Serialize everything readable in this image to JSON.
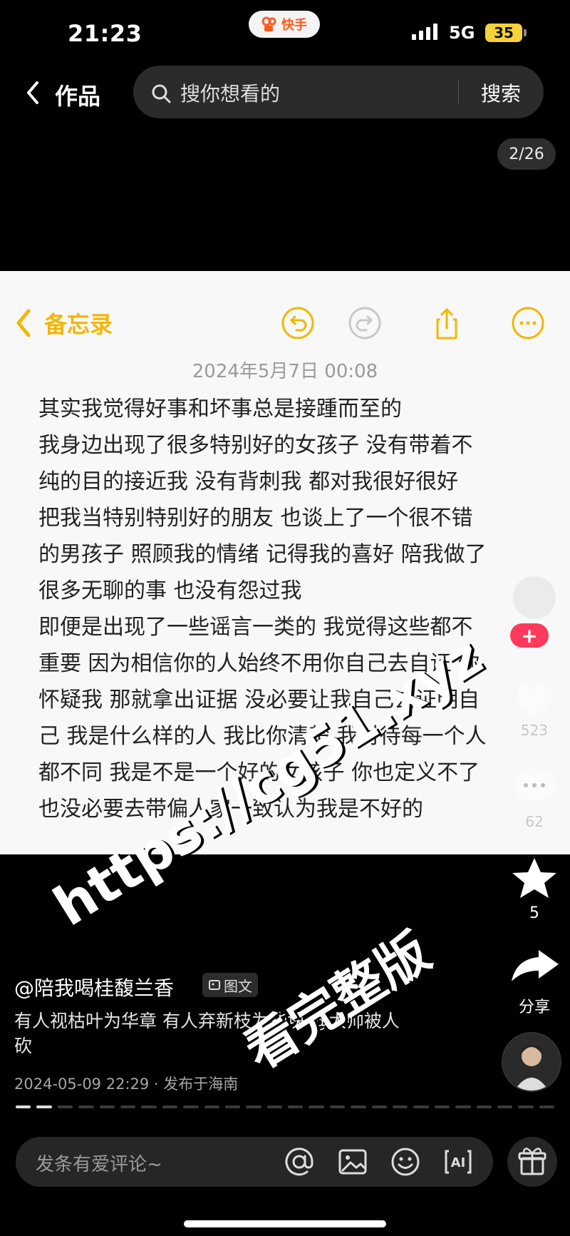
{
  "status_bar": {
    "time": "21:23",
    "app_name": "快手",
    "network": "5G",
    "battery": "35"
  },
  "header": {
    "back_label": "作品",
    "search_placeholder": "搜你想看的",
    "search_button": "搜索",
    "counter": "2/26"
  },
  "memo": {
    "back_label": "备忘录",
    "date": "2024年5月7日 00:08",
    "body": "其实我觉得好事和坏事总是接踵而至的\n我身边出现了很多特别好的女孩子 没有带着不\n纯的目的接近我 没有背刺我 都对我很好很好\n把我当特别特别好的朋友 也谈上了一个很不错\n的男孩子 照顾我的情绪 记得我的喜好 陪我做了\n很多无聊的事 也没有怨过我\n即便是出现了一些谣言一类的 我觉得这些都不\n重要 因为相信你的人始终不用你自己去自证 你\n怀疑我 那就拿出证据 没必要让我自己去证明自\n己 我是什么样的人 我比你清楚 我对待每一个人\n都不同 我是不是一个好的女孩子 你也定义不了\n也没必要去带偏人家一致认为我是不好的"
  },
  "side": {
    "like_count": "523",
    "comment_count": "62",
    "collect_count": "5",
    "share_label": "分享"
  },
  "caption": {
    "author": "@陪我喝桂馥兰香",
    "tag": "图文",
    "text": "有人视枯叶为华章 有人弃新枝为些块 @太帅被人砍",
    "meta": "2024-05-09 22:29 · 发布于海南"
  },
  "comment_bar": {
    "placeholder": "发条有爱评论~"
  },
  "watermark": {
    "line1": "https://cg51.xyz",
    "line2": "看完整版"
  },
  "colors": {
    "accent_yellow": "#f2b706",
    "plus_badge": "#ff3a5c",
    "background": "#000000"
  }
}
